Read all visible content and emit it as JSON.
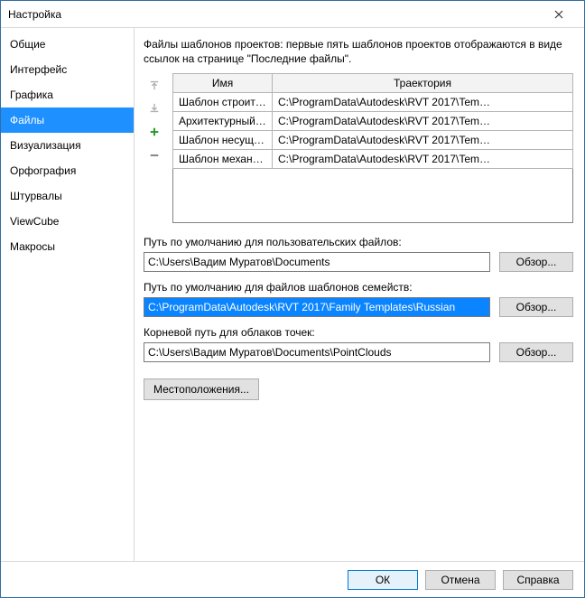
{
  "window": {
    "title": "Настройка"
  },
  "sidebar": {
    "items": [
      {
        "label": "Общие"
      },
      {
        "label": "Интерфейс"
      },
      {
        "label": "Графика"
      },
      {
        "label": "Файлы"
      },
      {
        "label": "Визуализация"
      },
      {
        "label": "Орфография"
      },
      {
        "label": "Штурвалы"
      },
      {
        "label": "ViewCube"
      },
      {
        "label": "Макросы"
      }
    ],
    "selectedIndex": 3
  },
  "content": {
    "description": "Файлы шаблонов проектов: первые пять шаблонов проектов отображаются в виде ссылок на странице \"Последние файлы\".",
    "table": {
      "headers": {
        "name": "Имя",
        "path": "Траектория"
      },
      "rows": [
        {
          "name": "Шаблон строител…",
          "path": "C:\\ProgramData\\Autodesk\\RVT 2017\\Tem…"
        },
        {
          "name": "Архитектурный ш…",
          "path": "C:\\ProgramData\\Autodesk\\RVT 2017\\Tem…"
        },
        {
          "name": "Шаблон несущей …",
          "path": "C:\\ProgramData\\Autodesk\\RVT 2017\\Tem…"
        },
        {
          "name": "Шаблон механиче…",
          "path": "C:\\ProgramData\\Autodesk\\RVT 2017\\Tem…"
        }
      ]
    },
    "userFiles": {
      "label": "Путь по умолчанию для пользовательских файлов:",
      "value": "C:\\Users\\Вадим Муратов\\Documents",
      "browse": "Обзор..."
    },
    "familyTemplates": {
      "label": "Путь по умолчанию для файлов шаблонов семейств:",
      "value": "C:\\ProgramData\\Autodesk\\RVT 2017\\Family Templates\\Russian",
      "browse": "Обзор..."
    },
    "pointClouds": {
      "label": "Корневой путь для облаков точек:",
      "value": "C:\\Users\\Вадим Муратов\\Documents\\PointClouds",
      "browse": "Обзор..."
    },
    "locationsButton": "Местоположения..."
  },
  "footer": {
    "ok": "ОК",
    "cancel": "Отмена",
    "help": "Справка"
  }
}
